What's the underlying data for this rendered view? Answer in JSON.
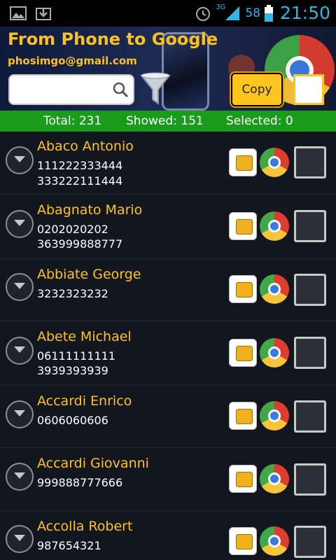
{
  "status_bar": {
    "icons_left": [
      "picture-icon",
      "download-icon"
    ],
    "network": "3G",
    "battery": "58",
    "time": "21:50"
  },
  "header": {
    "title": "From Phone to Google",
    "email": "phosimgo@gmail.com",
    "search_value": "",
    "copy_label": "Copy",
    "select_all_checked": false,
    "accent_color": "#ffc11f"
  },
  "summary": {
    "total": "Total: 231",
    "showed": "Showed: 151",
    "selected": "Selected: 0",
    "bar_color": "#1b9b1b"
  },
  "contacts": [
    {
      "name": "Abaco Antonio",
      "phones": [
        "111222333444",
        "333222111444"
      ],
      "selected": false
    },
    {
      "name": "Abagnato Mario",
      "phones": [
        "0202020202",
        "363999888777"
      ],
      "selected": false
    },
    {
      "name": "Abbiate George",
      "phones": [
        "3232323232"
      ],
      "selected": false
    },
    {
      "name": "Abete Michael",
      "phones": [
        "06111111111",
        "3939393939"
      ],
      "selected": false
    },
    {
      "name": "Accardi Enrico",
      "phones": [
        "0606060606"
      ],
      "selected": false
    },
    {
      "name": "Accardi Giovanni",
      "phones": [
        "999888777666"
      ],
      "selected": false
    },
    {
      "name": "Accolla Robert",
      "phones": [
        "987654321"
      ],
      "selected": false
    }
  ]
}
